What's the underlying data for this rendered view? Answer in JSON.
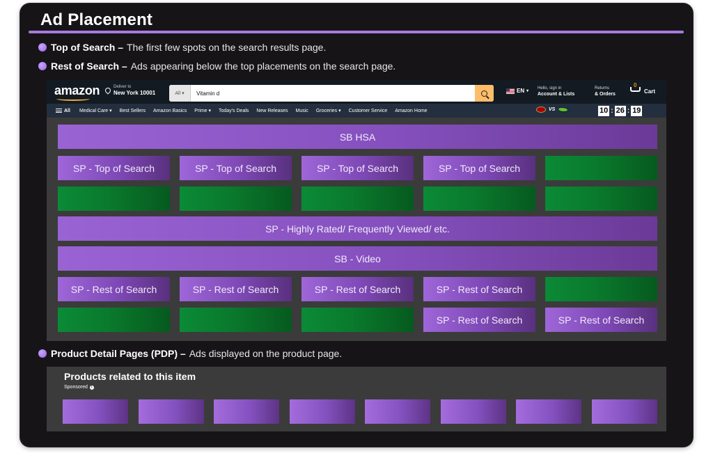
{
  "title": "Ad Placement",
  "bullets": [
    {
      "label": "Top of Search –",
      "desc": "The first few spots on the search results page."
    },
    {
      "label": "Rest of Search –",
      "desc": "Ads appearing below the top placements on the search page."
    },
    {
      "label": "Product Detail Pages (PDP) –",
      "desc": "Ads displayed on the product page."
    }
  ],
  "amazon": {
    "logo": "amazon",
    "deliver_line1": "Deliver to",
    "deliver_line2": "New York 10001",
    "search_category": "All",
    "search_value": "Vitamin d",
    "lang": "EN",
    "account_line1": "Hello, sign in",
    "account_line2": "Account & Lists",
    "orders_line1": "Returns",
    "orders_line2": "& Orders",
    "cart_count": "0",
    "cart_label": "Cart",
    "nav_items": [
      "All",
      "Medical Care",
      "Best Sellers",
      "Amazon Basics",
      "Prime",
      "Today's Deals",
      "New Releases",
      "Music",
      "Groceries",
      "Customer Service",
      "Amazon Home"
    ],
    "game_vs": "VS",
    "clock": [
      "10",
      "26",
      "19"
    ]
  },
  "placements": {
    "sb_hsa": "SB HSA",
    "sp_top": "SP - Top of Search",
    "sp_highly": "SP - Highly Rated/ Frequently Viewed/ etc.",
    "sb_video": "SB - Video",
    "sp_rest": "SP - Rest of Search"
  },
  "pdp": {
    "title": "Products related to this item",
    "sponsored": "Sponsored",
    "info_icon": "i"
  },
  "colors": {
    "accent_purple": "#a77bdb",
    "sponsored_green": "#0a7a2d",
    "amazon_dark": "#131a22",
    "amazon_nav": "#232f3e",
    "search_button": "#febd69"
  }
}
